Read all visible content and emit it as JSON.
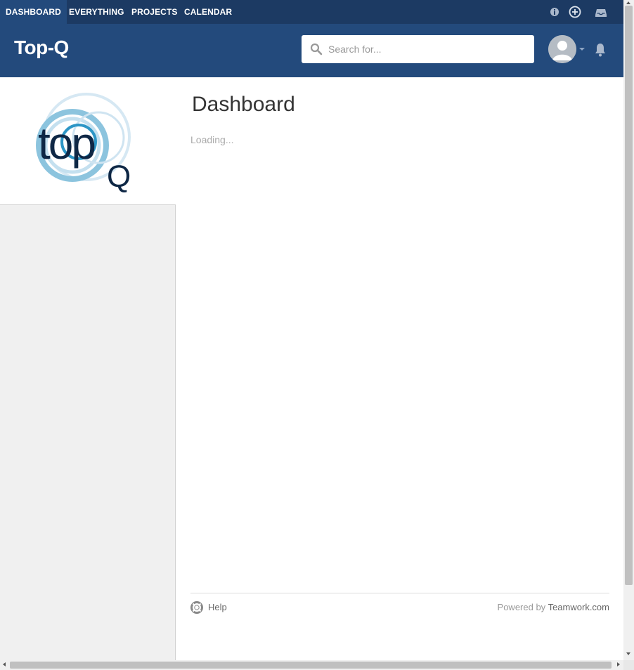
{
  "nav": {
    "tabs": [
      {
        "label": "DASHBOARD",
        "active": true
      },
      {
        "label": "EVERYTHING",
        "active": false
      },
      {
        "label": "PROJECTS",
        "active": false
      },
      {
        "label": "CALENDAR",
        "active": false
      }
    ],
    "icons": [
      "info-icon",
      "add-circle-icon",
      "inbox-icon"
    ]
  },
  "header": {
    "site_title": "Top-Q",
    "search_placeholder": "Search for...",
    "bg_color": "#234a7c",
    "nav_bg_color": "#1c3a63"
  },
  "sidebar": {
    "logo_text": "topQ"
  },
  "main": {
    "page_title": "Dashboard",
    "loading_text": "Loading...",
    "footer": {
      "help_label": "Help",
      "powered_prefix": "Powered by",
      "powered_link": "Teamwork.com"
    }
  }
}
